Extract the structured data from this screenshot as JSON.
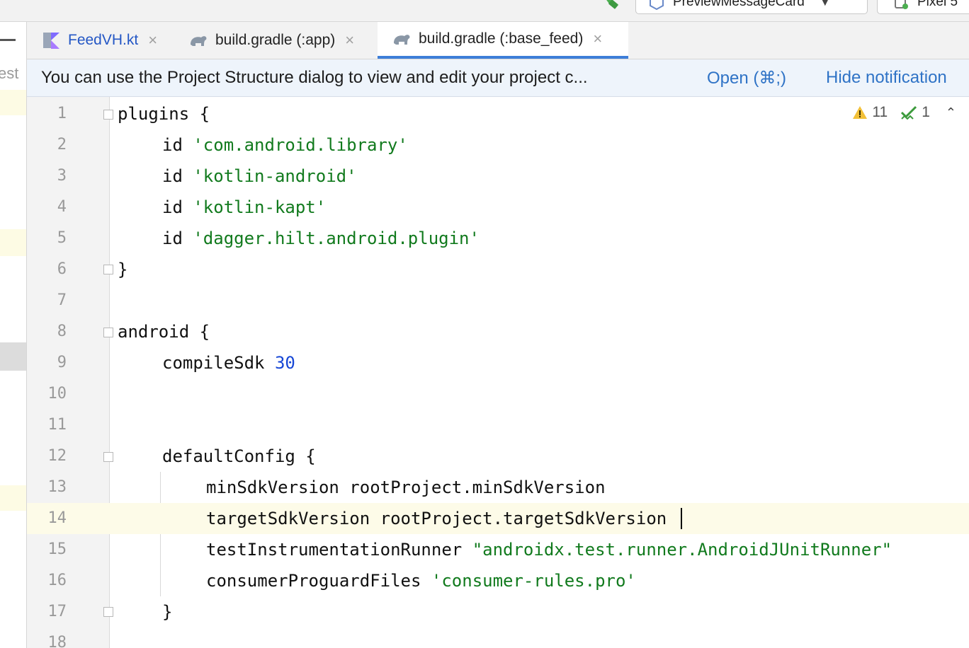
{
  "toolbar": {
    "run_config": "PreviewMessageCard",
    "device": "Pixel 5",
    "build_icon": "hammer-icon"
  },
  "tool_strip": {
    "label": "Test"
  },
  "tabs": [
    {
      "label": "FeedVH.kt",
      "icon": "kotlin-file-icon",
      "active": false
    },
    {
      "label": "build.gradle (:app)",
      "icon": "gradle-elephant-icon",
      "active": false
    },
    {
      "label": "build.gradle (:base_feed)",
      "icon": "gradle-elephant-icon",
      "active": true
    }
  ],
  "notification": {
    "message": "You can use the Project Structure dialog to view and edit your project c...",
    "open_label": "Open (⌘;)",
    "hide_label": "Hide notification"
  },
  "inspections": {
    "warnings": "11",
    "weak_warnings": "1"
  },
  "editor": {
    "lines": [
      {
        "no": "1",
        "text": "plugins {"
      },
      {
        "no": "2",
        "text": "id 'com.android.library'"
      },
      {
        "no": "3",
        "text": "id 'kotlin-android'"
      },
      {
        "no": "4",
        "text": "id 'kotlin-kapt'"
      },
      {
        "no": "5",
        "text": "id 'dagger.hilt.android.plugin'"
      },
      {
        "no": "6",
        "text": "}"
      },
      {
        "no": "7",
        "text": ""
      },
      {
        "no": "8",
        "text": "android {"
      },
      {
        "no": "9",
        "text": "compileSdk 30"
      },
      {
        "no": "10",
        "text": ""
      },
      {
        "no": "11",
        "text": ""
      },
      {
        "no": "12",
        "text": "defaultConfig {"
      },
      {
        "no": "13",
        "text": "minSdkVersion rootProject.minSdkVersion"
      },
      {
        "no": "14",
        "text": "targetSdkVersion rootProject.targetSdkVersion"
      },
      {
        "no": "15",
        "text": "testInstrumentationRunner \"androidx.test.runner.AndroidJUnitRunner\""
      },
      {
        "no": "16",
        "text": "consumerProguardFiles 'consumer-rules.pro'"
      },
      {
        "no": "17",
        "text": "}"
      },
      {
        "no": "18",
        "text": ""
      }
    ],
    "current_line": "14",
    "colors": {
      "string": "#117a1d",
      "number": "#1747d6",
      "line_number": "#999999",
      "current_line_bg": "#fdfbe8"
    }
  }
}
